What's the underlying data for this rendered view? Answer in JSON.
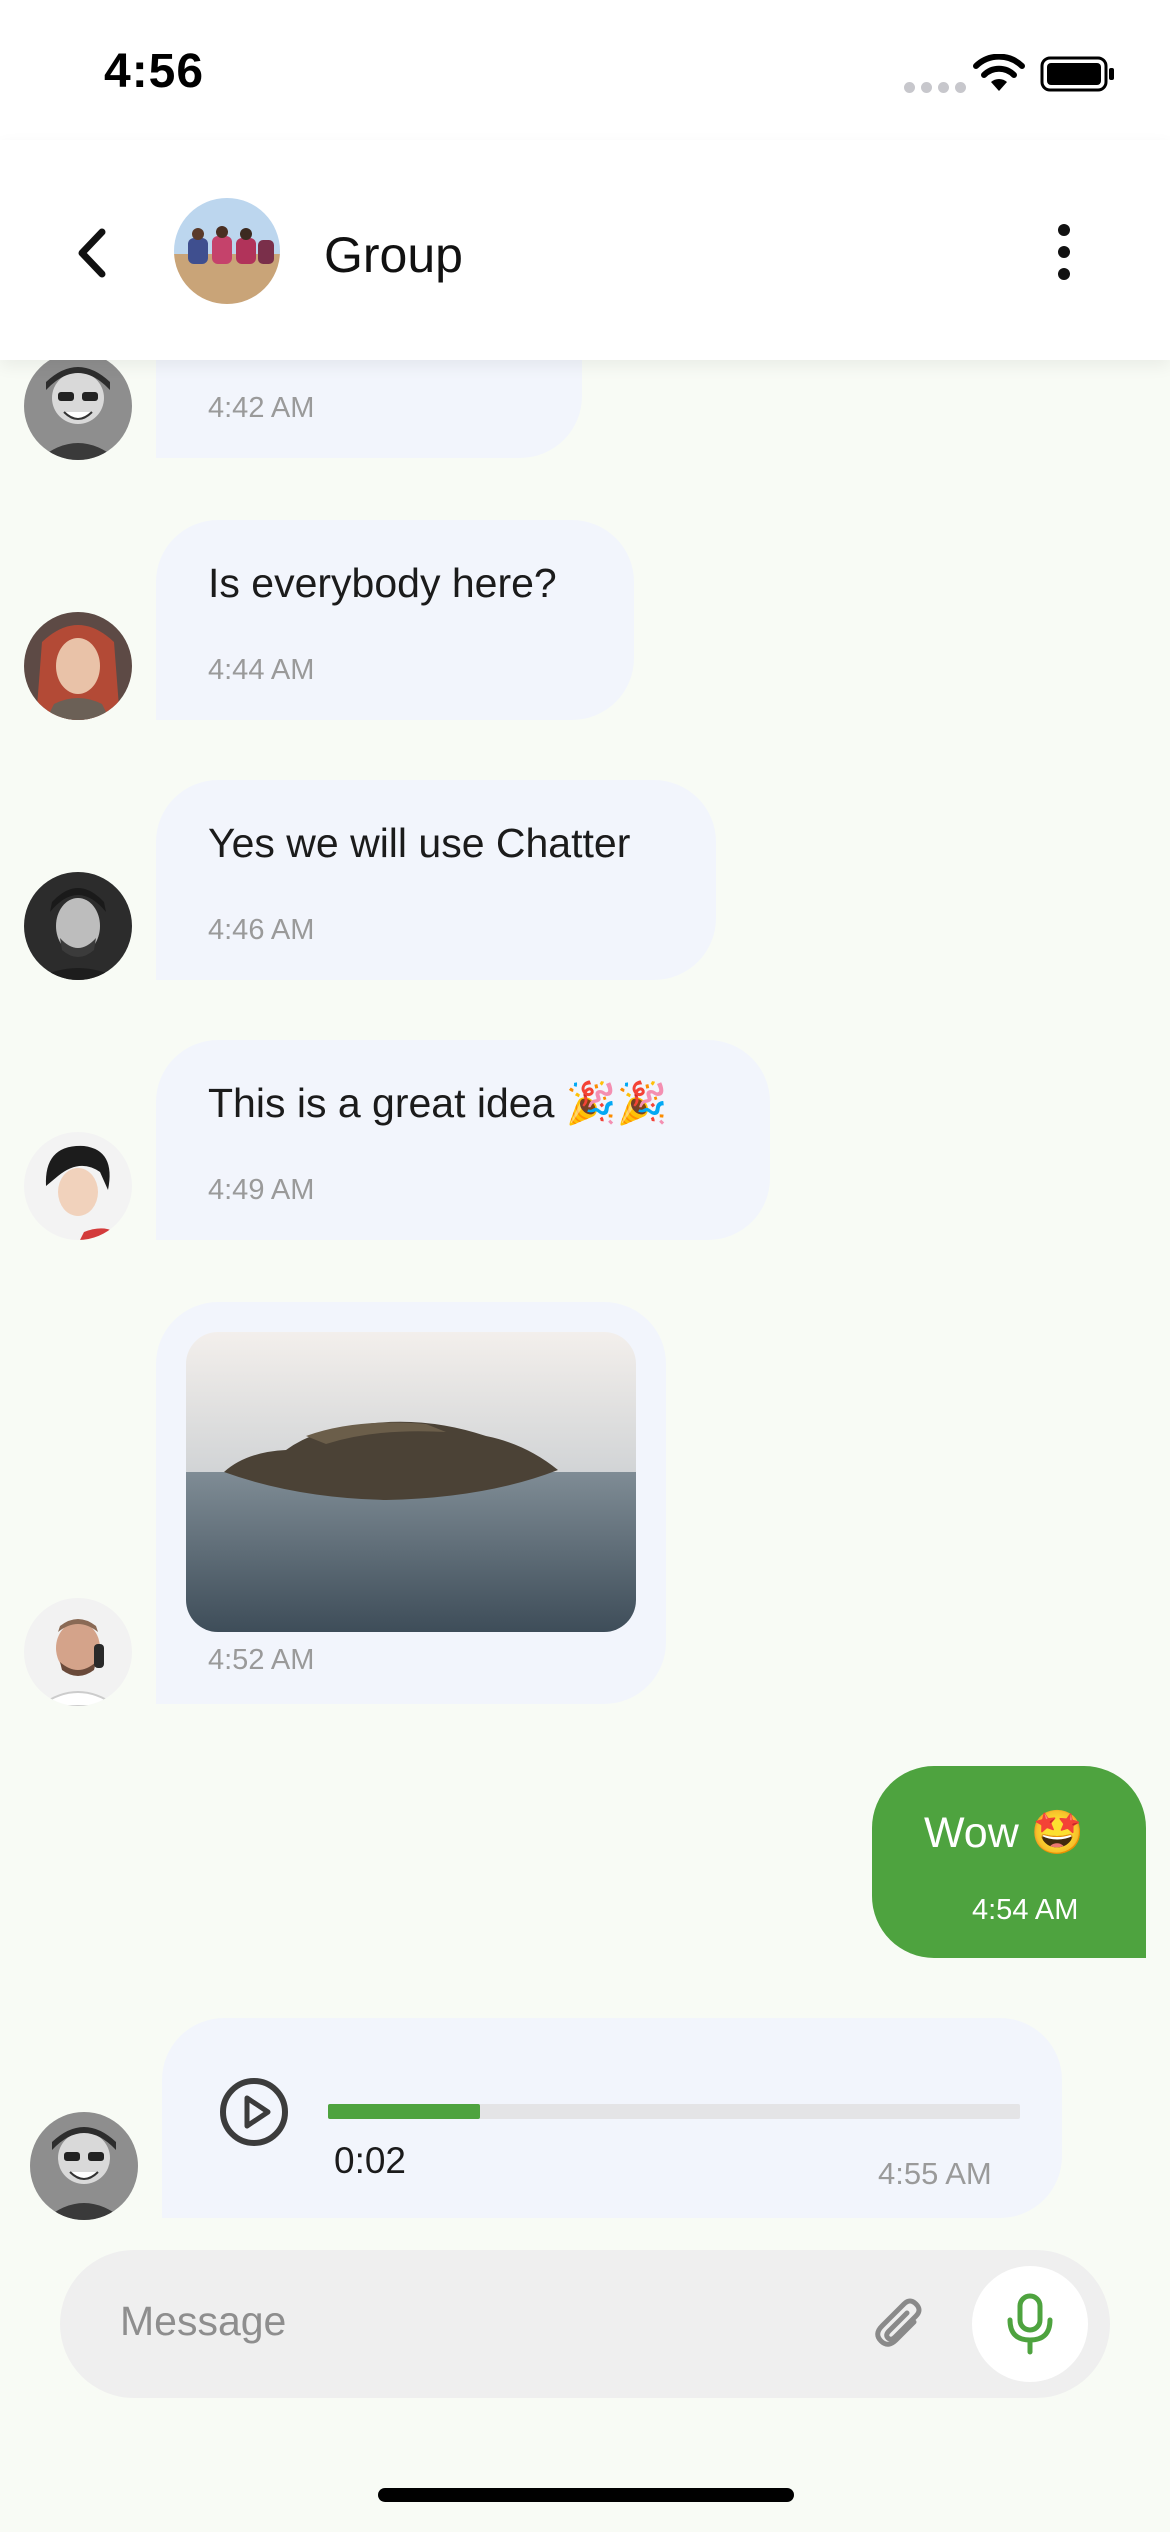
{
  "status_bar": {
    "time": "4:56"
  },
  "header": {
    "title": "Group"
  },
  "messages": [
    {
      "time": "4:42 AM"
    },
    {
      "text": "Is everybody here?",
      "time": "4:44 AM"
    },
    {
      "text": "Yes we will use Chatter",
      "time": "4:46 AM"
    },
    {
      "text": "This is a great idea 🎉🎉",
      "time": "4:49 AM"
    },
    {
      "time": "4:52 AM"
    },
    {
      "text": "Wow 🤩",
      "time": "4:54 AM"
    }
  ],
  "voice_message": {
    "duration": "0:02",
    "time": "4:55 AM",
    "progress": 0.22
  },
  "composer": {
    "placeholder": "Message"
  },
  "colors": {
    "accent": "#4ea33f",
    "incoming_bubble": "#f2f5fc",
    "background": "#f8fbf5"
  },
  "icons": [
    "back-icon",
    "more-icon",
    "play-icon",
    "attach-icon",
    "mic-icon",
    "wifi-icon",
    "battery-icon"
  ]
}
